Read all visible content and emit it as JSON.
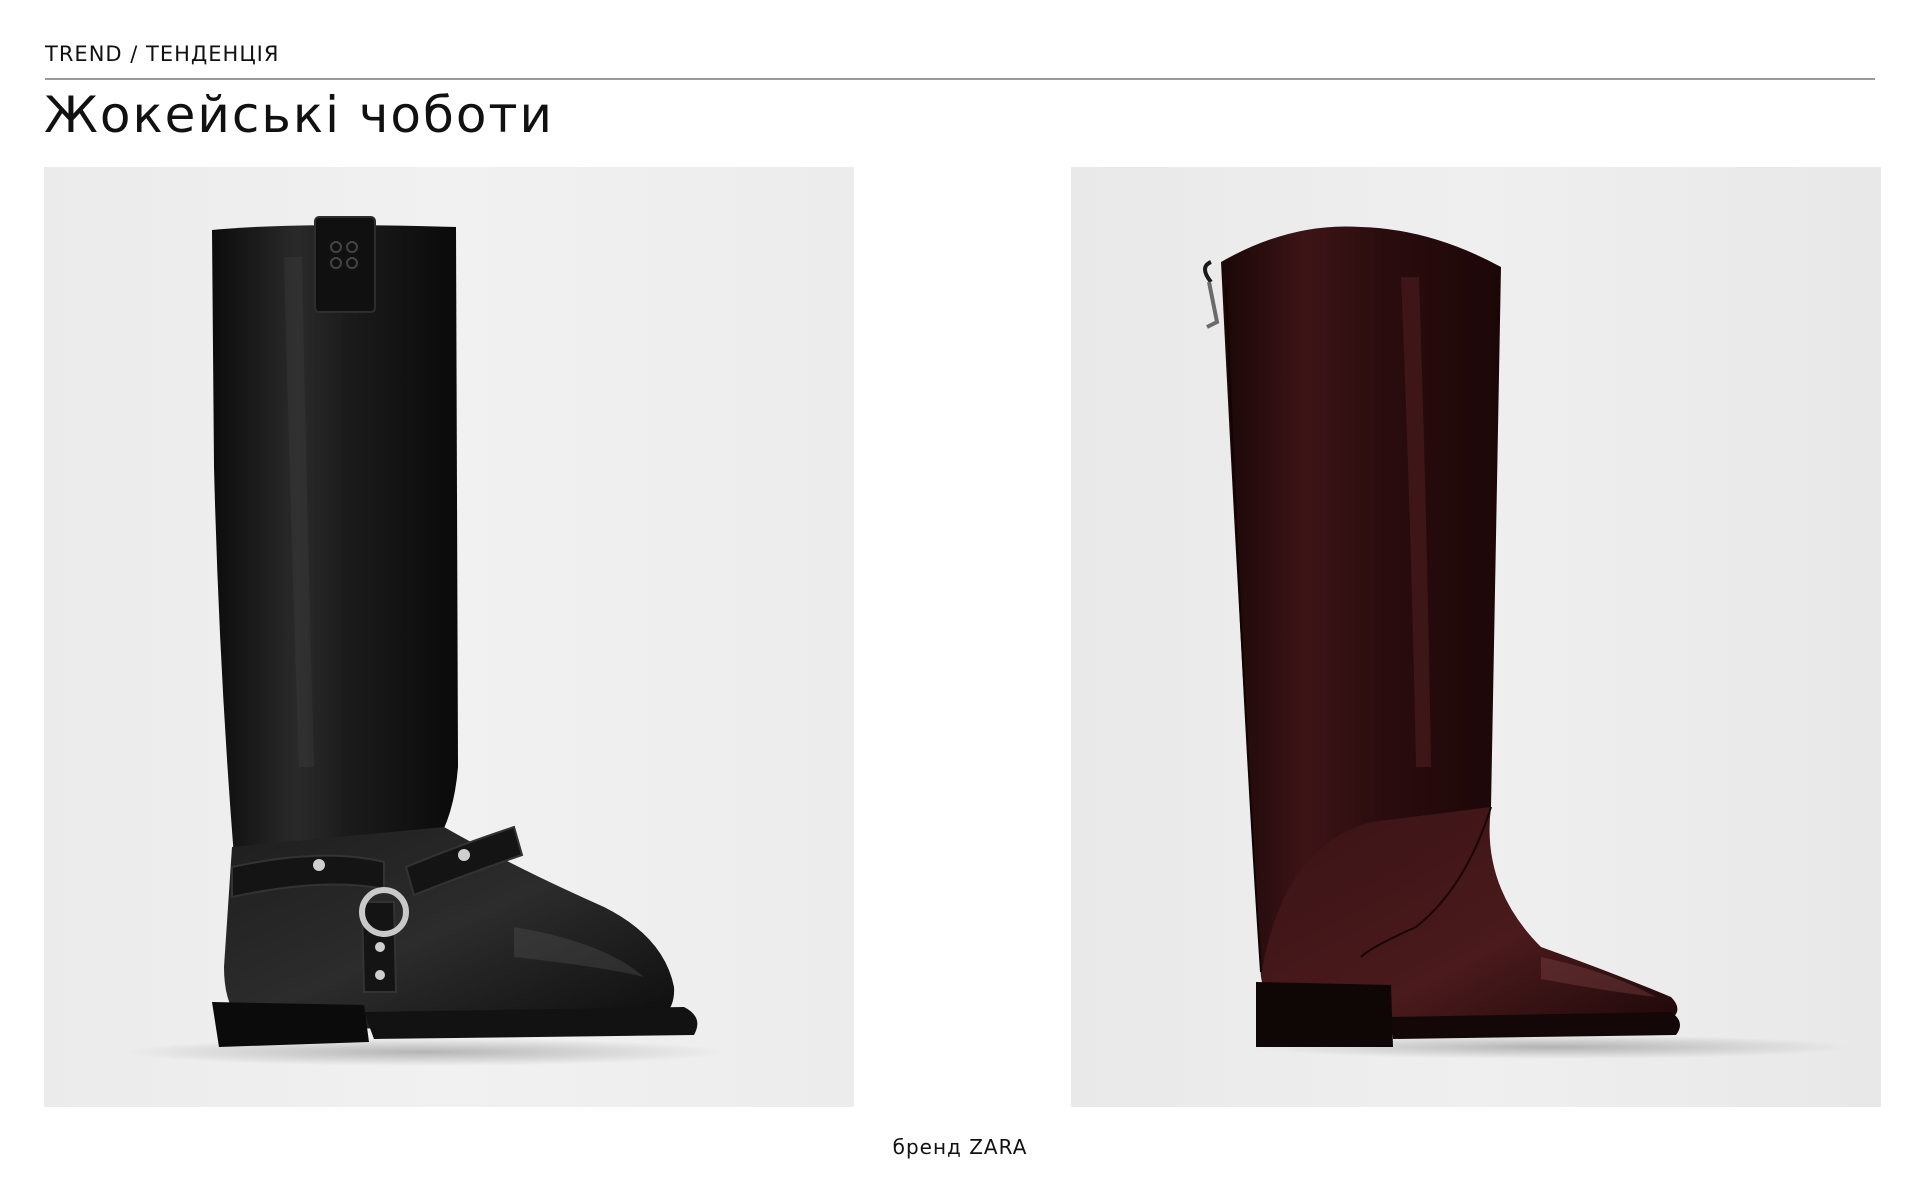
{
  "header": {
    "label": "TREND / ТЕНДЕНЦІЯ",
    "title": "Жокейські чоботи"
  },
  "products": [
    {
      "name": "black-leather-harness-boot",
      "color": "#151515"
    },
    {
      "name": "burgundy-patent-riding-boot",
      "color": "#3a1214"
    }
  ],
  "caption": "бренд ZARA"
}
